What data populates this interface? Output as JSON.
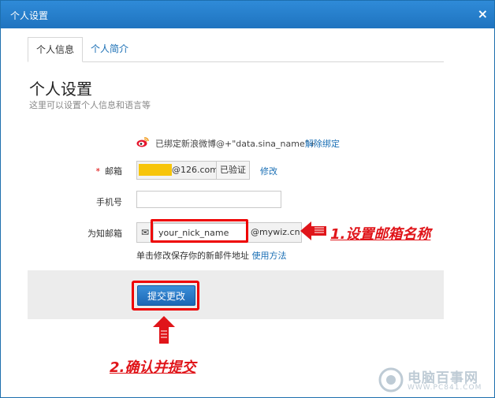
{
  "dialog": {
    "title": "个人设置",
    "close_label": "×"
  },
  "tabs": [
    {
      "label": "个人信息",
      "active": true
    },
    {
      "label": "个人简介",
      "active": false
    }
  ],
  "header": {
    "title": "个人设置",
    "subtitle": "这里可以设置个人信息和语言等"
  },
  "weibo": {
    "icon": "weibo-icon",
    "text": "已绑定新浪微博@+\"data.sina_name\"+",
    "unbind_label": "解除绑定"
  },
  "email": {
    "label": "邮箱",
    "required_mark": "*",
    "domain": "@126.com",
    "status": "已验证",
    "modify_label": "修改"
  },
  "phone": {
    "label": "手机号",
    "value": ""
  },
  "wiz_email": {
    "label": "为知邮箱",
    "icon": "envelope-icon",
    "value": "your_nick_name",
    "domain": "@mywiz.cn",
    "hint": "单击修改保存你的新邮件地址",
    "hint_link": "使用方法"
  },
  "actions": {
    "submit_label": "提交更改"
  },
  "annotations": {
    "step1": "1.设置邮箱名称",
    "step2": "2.确认并提交",
    "color": "#e0151a"
  },
  "watermark": {
    "text": "电脑百事网",
    "url_text": "WWW.PC841.COM"
  },
  "colors": {
    "titlebar": "#1f73bf",
    "link": "#1a6fb5",
    "highlight_box": "#e00000"
  }
}
